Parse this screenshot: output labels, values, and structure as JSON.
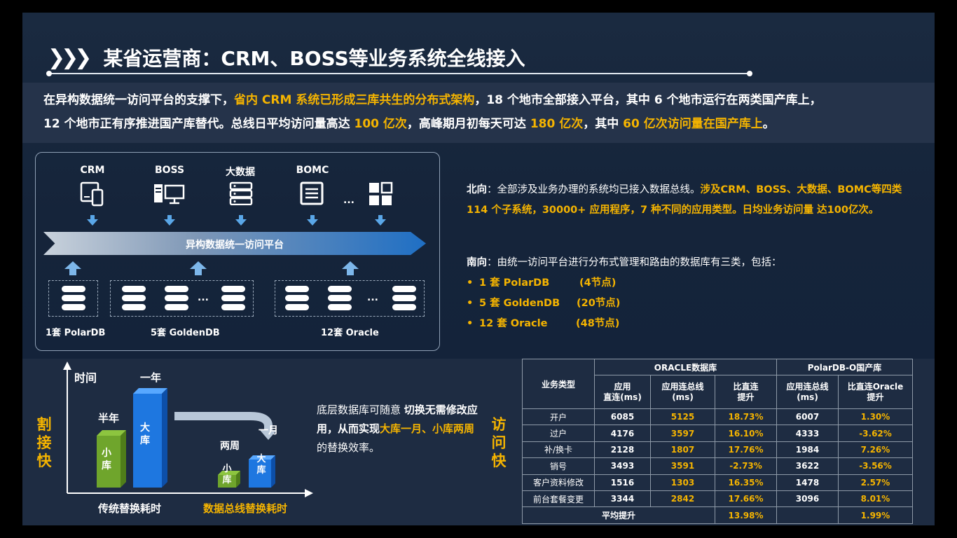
{
  "title": {
    "chevrons": "❯❯❯",
    "text": "某省运营商：CRM、BOSS等业务系统全线接入"
  },
  "intro": {
    "p1_a": "在异构数据统一访问平台的支撑下，",
    "p1_b": "省内 CRM 系统已形成三库共生的分布式架构",
    "p1_c": "，18 个地市全部接入平台，其中 6 个地市运行在两类国产库上，",
    "p2_a": "12 个地市正有序推进国产库替代。总线日平均访问量高达 ",
    "p2_b": "100 亿次",
    "p2_c": "，高峰期月初每天可达 ",
    "p2_d": "180 亿次",
    "p2_e": "，其中 ",
    "p2_f": "60 亿次访问量在国产库上",
    "p2_g": "。"
  },
  "arch": {
    "systems": [
      "CRM",
      "BOSS",
      "大数据",
      "BOMC"
    ],
    "ellipsis": "...",
    "platform": "异构数据统一访问平台",
    "db_ellipsis": "...",
    "db_labels": [
      "1套 PolarDB",
      "5套 GoldenDB",
      "12套 Oracle"
    ]
  },
  "north": {
    "label": "北向",
    "text_a": "：全部涉及业务办理的系统均已接入数据总线。",
    "text_b": "涉及CRM、BOSS、大数据、BOMC等四类 114 个子系统，30000+ 应用程序，7 种不同的应用类型。日均业务访问量 达100亿次。"
  },
  "south": {
    "label": "南向",
    "text": "：由统一访问平台进行分布式管理和路由的数据库有三类，包括：",
    "items": [
      {
        "bullet": "•",
        "name": "1  套 PolarDB",
        "nodes": "(4节点)"
      },
      {
        "bullet": "•",
        "name": "5  套 GoldenDB",
        "nodes": "(20节点)"
      },
      {
        "bullet": "•",
        "name": "12 套 Oracle",
        "nodes": "(48节点)"
      }
    ]
  },
  "cut": {
    "vlabel": [
      "割",
      "接",
      "快"
    ],
    "axis_y": "时间",
    "half_year": "半年",
    "one_year": "一年",
    "two_weeks": "两周",
    "one_month": "一月",
    "small": "小库",
    "big": "大库",
    "x1": "传统替换耗时",
    "x2": "数据总线替换耗时",
    "note_a": "底层数据库可随意 ",
    "note_b": "切换无需修改应用，从而实现",
    "note_c": "大库一月、小库两周",
    "note_d": "的替换效率。"
  },
  "access": {
    "vlabel": [
      "访",
      "问",
      "快"
    ],
    "group1": "ORACLE数据库",
    "group2": "PolarDB-O国产库",
    "col0": "业务类型",
    "cols": [
      "应用\n直连(ms)",
      "应用连总线\n(ms)",
      "比直连\n提升",
      "应用连总线\n(ms)",
      "比直连Oracle\n提升"
    ],
    "rows": [
      [
        "开户",
        "6085",
        "5125",
        "18.73%",
        "6007",
        "1.30%"
      ],
      [
        "过户",
        "4176",
        "3597",
        "16.10%",
        "4333",
        "-3.62%"
      ],
      [
        "补/换卡",
        "2128",
        "1807",
        "17.76%",
        "1984",
        "7.26%"
      ],
      [
        "销号",
        "3493",
        "3591",
        "-2.73%",
        "3622",
        "-3.56%"
      ],
      [
        "客户资料修改",
        "1516",
        "1303",
        "16.35%",
        "1478",
        "2.57%"
      ],
      [
        "前台套餐变更",
        "3344",
        "2842",
        "17.66%",
        "3096",
        "8.01%"
      ]
    ],
    "avg_label": "平均提升",
    "avg1": "13.98%",
    "avg2": "1.99%"
  },
  "colors": {
    "accent": "#f5b400",
    "bg": "#15243a",
    "green": "#6fa52c",
    "blue": "#1e77e0"
  }
}
